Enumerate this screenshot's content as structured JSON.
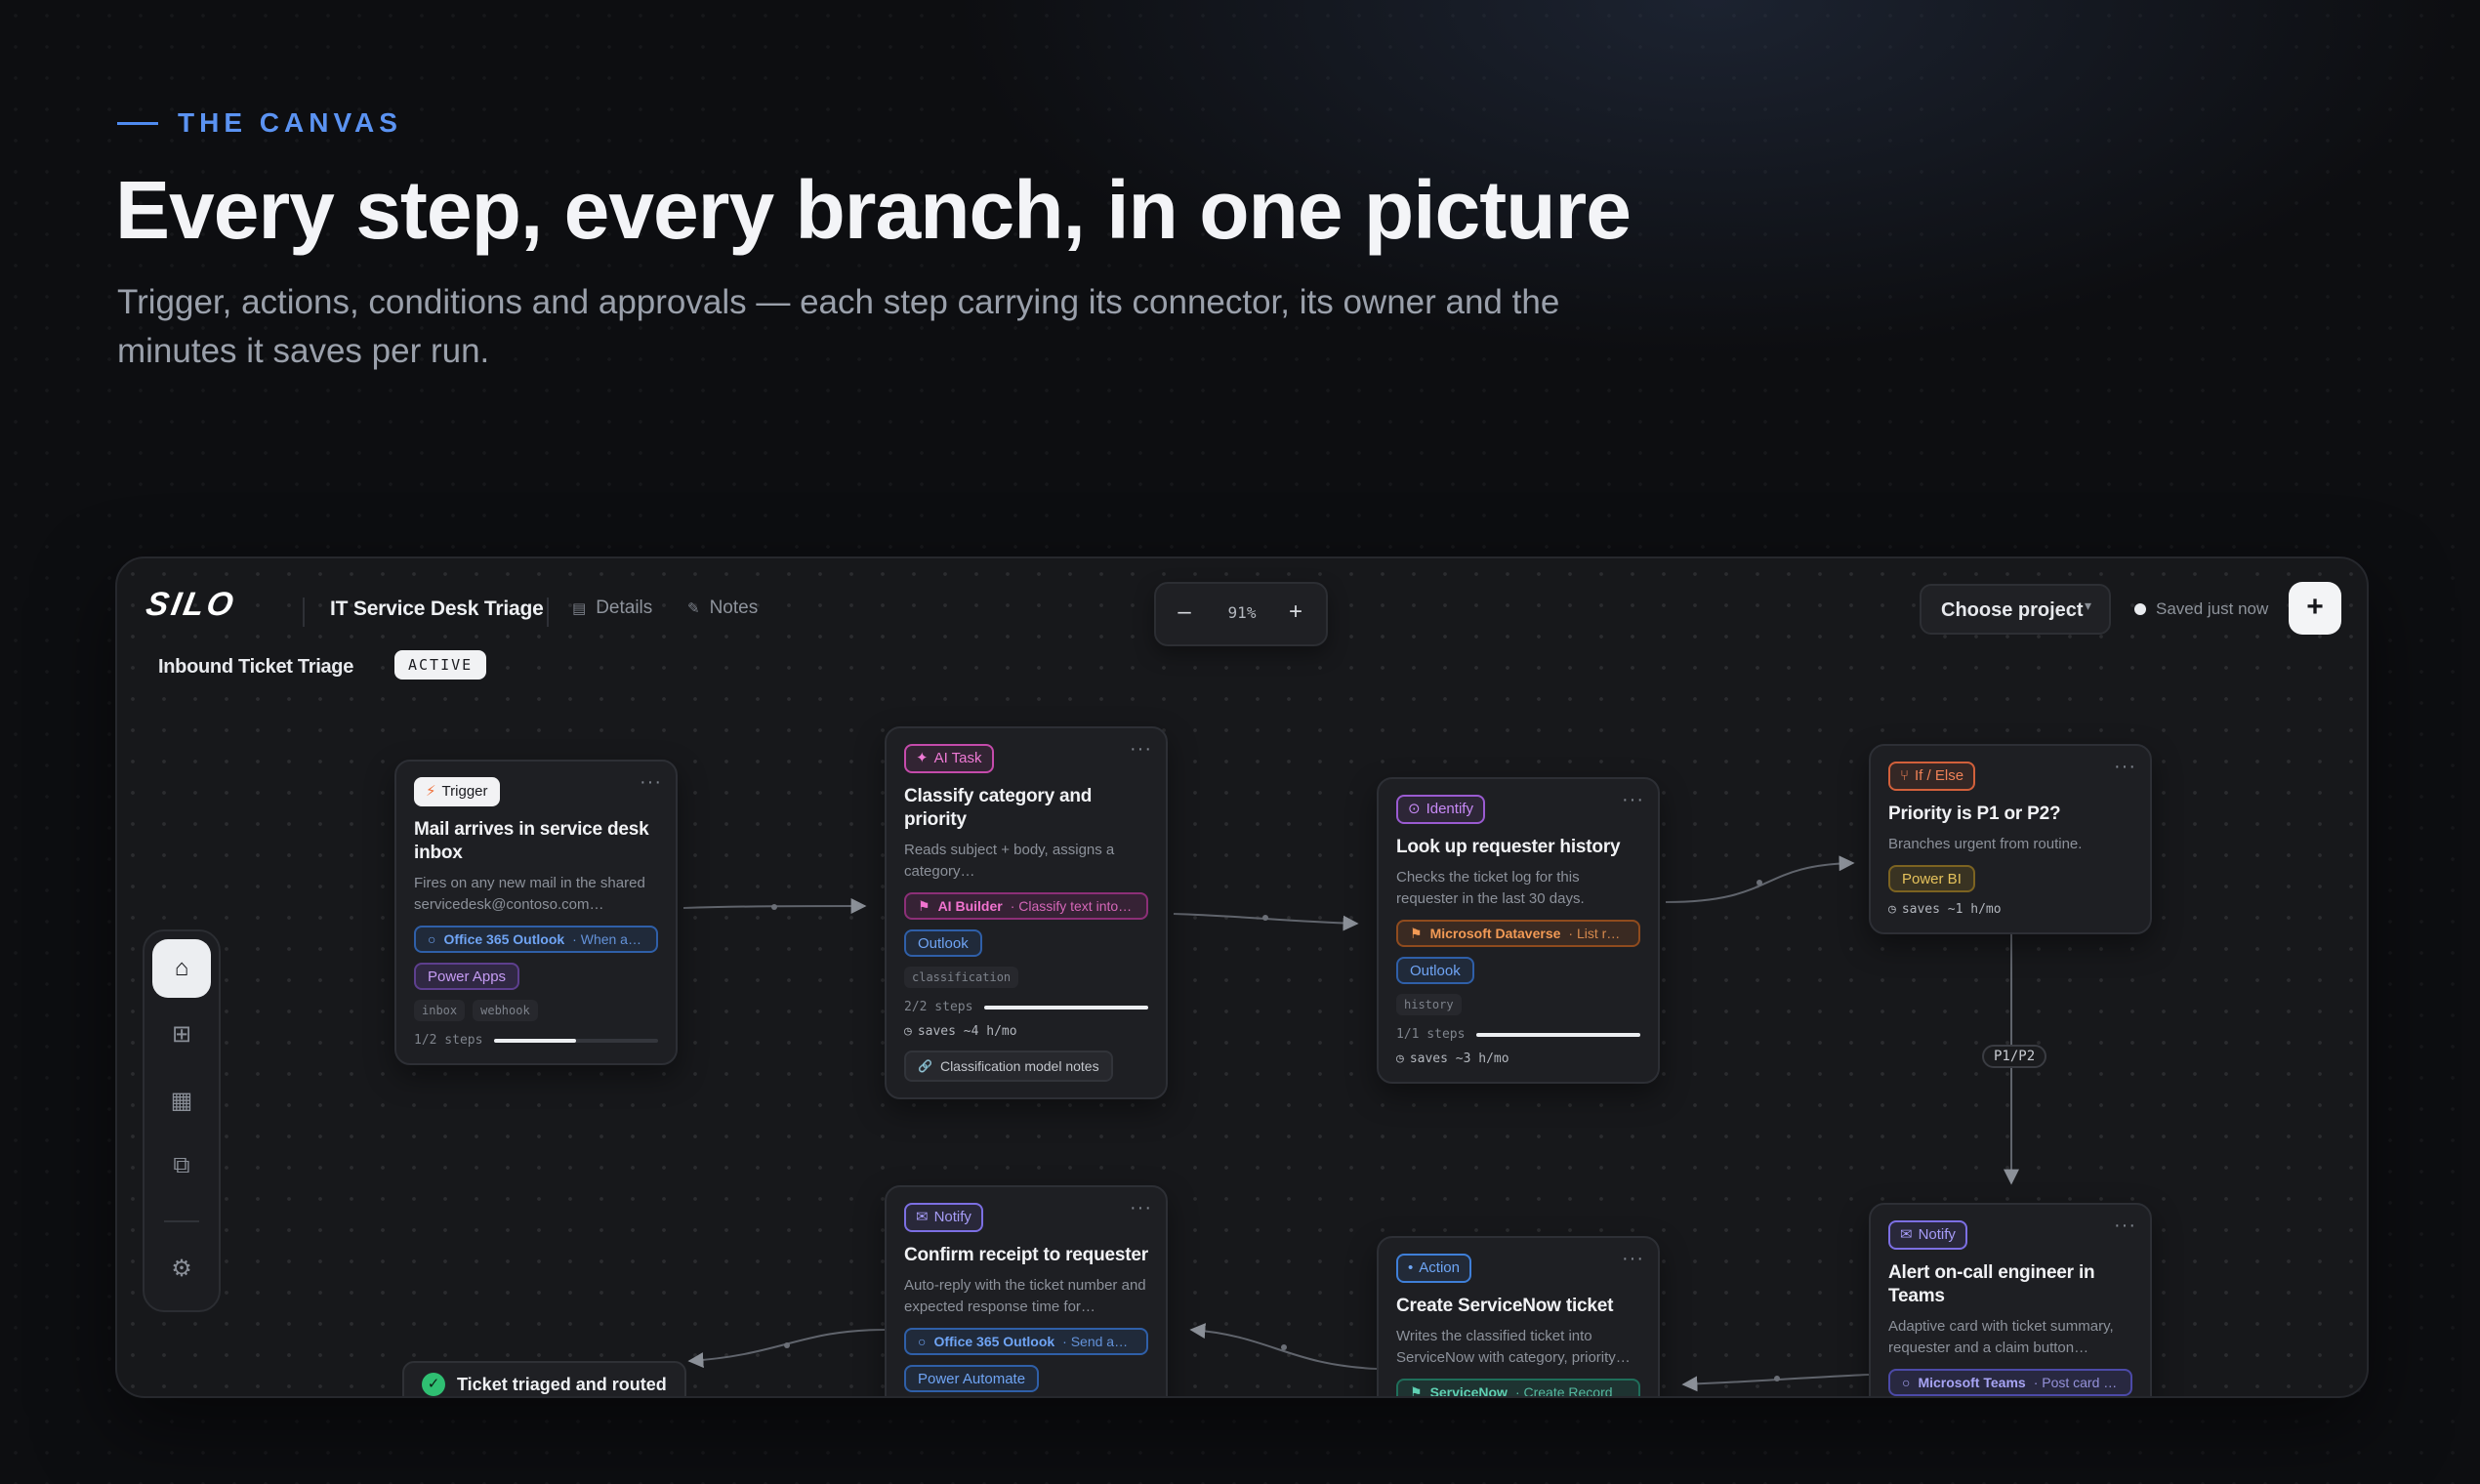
{
  "hero": {
    "eyebrow": "THE CANVAS",
    "title": "Every step, every branch, in one picture",
    "subtitle": "Trigger, actions, conditions and approvals — each step carrying its connector, its owner and the minutes it saves per run."
  },
  "app": {
    "logo": "SILO",
    "flow_title": "IT Service Desk Triage",
    "tabs": [
      {
        "label": "Details",
        "icon": "document-icon"
      },
      {
        "label": "Notes",
        "icon": "pencil-icon"
      }
    ],
    "zoom": {
      "minus": "–",
      "value": "91%",
      "plus": "+"
    },
    "project_select": {
      "label": "Choose project",
      "chevron": "▾"
    },
    "save_status": "Saved just now",
    "add_button": "+",
    "flow_name": "Inbound Ticket Triage",
    "status_badge": "ACTIVE"
  },
  "rail": {
    "items": [
      {
        "name": "home-icon",
        "glyph": "⌂",
        "active": true
      },
      {
        "name": "grid-icon",
        "glyph": "⊞"
      },
      {
        "name": "table-icon",
        "glyph": "▦"
      },
      {
        "name": "layers-icon",
        "glyph": "⧉"
      },
      {
        "name": "settings-icon",
        "glyph": "⚙"
      }
    ]
  },
  "nodes": {
    "trigger": {
      "kind": "Trigger",
      "icon": "⚡",
      "title": "Mail arrives in service desk inbox",
      "desc": "Fires on any new mail in the shared servicedesk@contoso.com…",
      "chip": {
        "name": "Office 365 Outlook",
        "detail": "· When a …"
      },
      "pill": "Power Apps",
      "tags": [
        "inbox",
        "webhook"
      ],
      "progress_label": "1/2 steps",
      "progress": 0.5
    },
    "classify": {
      "kind": "AI Task",
      "icon": "✦",
      "title": "Classify category and priority",
      "desc": "Reads subject + body, assigns a category…",
      "chip": {
        "name": "AI Builder",
        "detail": "· Classify text into …"
      },
      "pill": "Outlook",
      "tags": [
        "classification"
      ],
      "progress_label": "2/2 steps",
      "progress": 1.0,
      "saves": "saves ~4 h/mo",
      "notes": "Classification model notes"
    },
    "lookup": {
      "kind": "Identify",
      "icon": "⊙",
      "title": "Look up requester history",
      "desc": "Checks the ticket log for this requester in the last 30 days.",
      "chip": {
        "name": "Microsoft Dataverse",
        "detail": "· List ro…"
      },
      "pill": "Outlook",
      "tags": [
        "history"
      ],
      "progress_label": "1/1 steps",
      "progress": 1.0,
      "saves": "saves ~3 h/mo"
    },
    "priority": {
      "kind": "If / Else",
      "icon": "⑂",
      "title": "Priority is P1 or P2?",
      "desc": "Branches urgent from routine.",
      "pill": "Power BI",
      "saves": "saves ~1 h/mo"
    },
    "alert": {
      "kind": "Notify",
      "icon": "✉",
      "title": "Alert on-call engineer in Teams",
      "desc": "Adaptive card with ticket summary, requester and a claim button…",
      "chip": {
        "name": "Microsoft Teams",
        "detail": "· Post card i…"
      }
    },
    "create": {
      "kind": "Action",
      "icon": "•",
      "title": "Create ServiceNow ticket",
      "desc": "Writes the classified ticket into ServiceNow with category, priority…",
      "chip": {
        "name": "ServiceNow",
        "detail": "· Create Record"
      }
    },
    "confirm": {
      "kind": "Notify",
      "icon": "✉",
      "title": "Confirm receipt to requester",
      "desc": "Auto-reply with the ticket number and expected response time for…",
      "chip": {
        "name": "Office 365 Outlook",
        "detail": "· Send an…"
      },
      "pill": "Power Automate"
    }
  },
  "edge_label": "P1/P2",
  "end_node": {
    "label": "Ticket triaged and routed",
    "icon": "✓"
  },
  "menu_glyph": "···",
  "clock_glyph": "◷",
  "link_glyph": "🔗"
}
